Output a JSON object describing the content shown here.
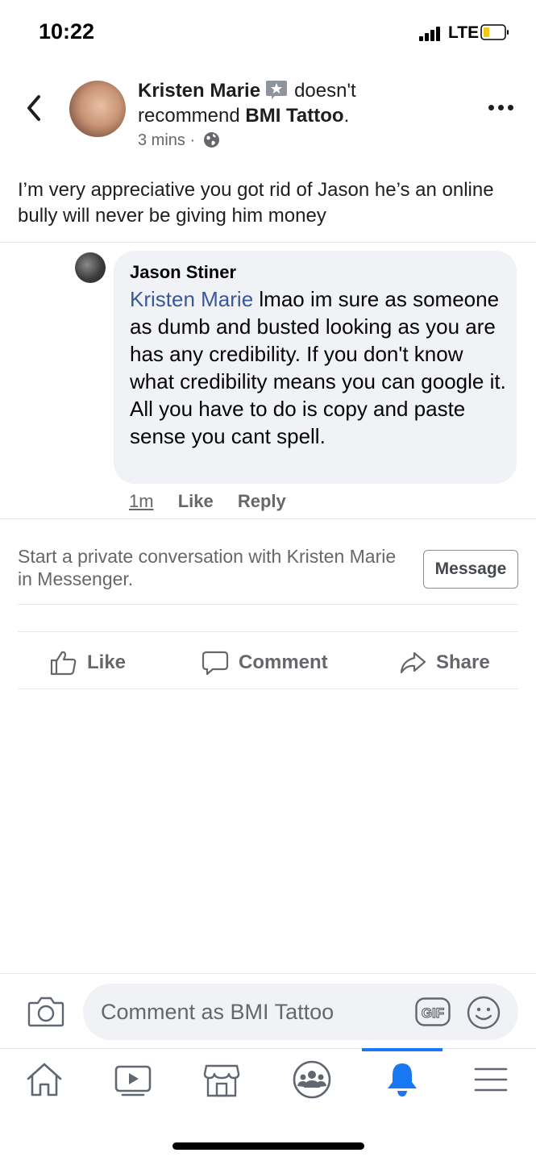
{
  "status_bar": {
    "time": "10:22",
    "network": "LTE"
  },
  "header": {
    "author": "Kristen Marie",
    "verb": "doesn't",
    "verb2": "recommend",
    "page": "BMI Tattoo",
    "period": ".",
    "timestamp": "3 mins",
    "separator": "·"
  },
  "post": {
    "text": "I’m very appreciative you got rid of Jason he’s an online bully will never be giving him money"
  },
  "comment": {
    "author": "Jason Stiner",
    "mention": "Kristen Marie",
    "text": " lmao im sure as someone as dumb and busted looking as you are has any credibility.  If you don't know what credibility means you can google it. All you have to do is copy and paste sense you cant spell.",
    "time": "1m",
    "like_label": "Like",
    "reply_label": "Reply"
  },
  "messenger_prompt": {
    "text": "Start a private conversation with Kristen Marie in Messenger.",
    "button_label": "Message"
  },
  "actions": {
    "like": "Like",
    "comment": "Comment",
    "share": "Share"
  },
  "composer": {
    "placeholder": "Comment as BMI Tattoo",
    "gif_label": "GIF"
  },
  "tabbar": {
    "items": [
      "home-icon",
      "watch-icon",
      "marketplace-icon",
      "groups-icon",
      "notifications-icon",
      "menu-icon"
    ],
    "active": "notifications-icon",
    "accent": "#1877f2"
  }
}
